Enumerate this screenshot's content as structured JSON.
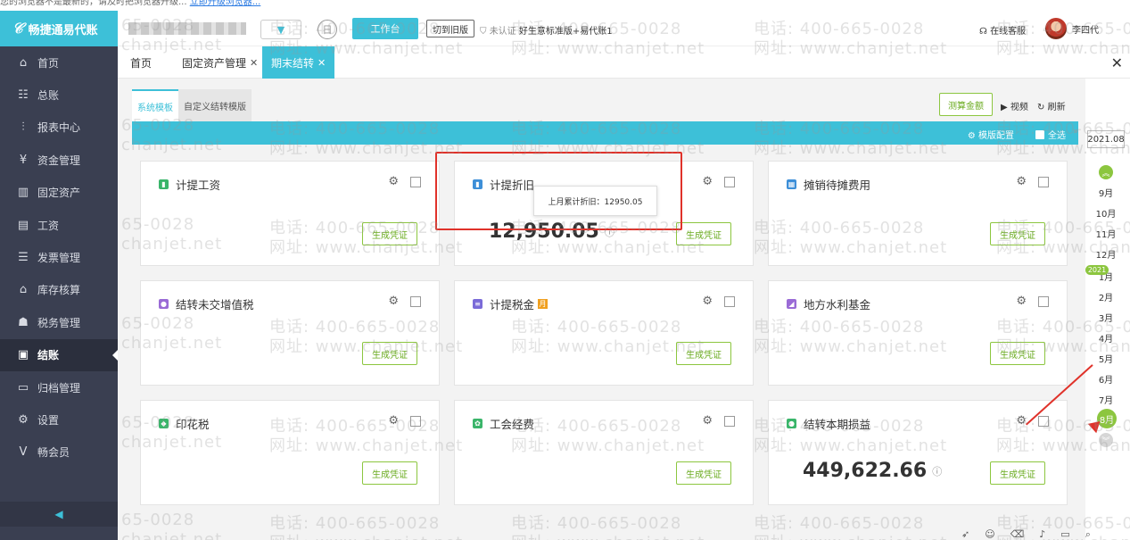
{
  "top_notice": {
    "text": "您的浏览器不是最新的，请及时把浏览器升级...",
    "link": "立即升级浏览器..."
  },
  "sidebar": {
    "brand": "畅捷通易代账",
    "items": [
      {
        "label": "首页",
        "icon": "home-icon",
        "glyph": "⌂"
      },
      {
        "label": "总账",
        "icon": "ledger-icon",
        "glyph": "☷"
      },
      {
        "label": "报表中心",
        "icon": "report-chart-icon",
        "glyph": "⫶"
      },
      {
        "label": "资金管理",
        "icon": "money-bag-icon",
        "glyph": "¥"
      },
      {
        "label": "固定资产",
        "icon": "building-icon",
        "glyph": "▥"
      },
      {
        "label": "工资",
        "icon": "salary-icon",
        "glyph": "▤"
      },
      {
        "label": "发票管理",
        "icon": "invoice-icon",
        "glyph": "☰"
      },
      {
        "label": "库存核算",
        "icon": "warehouse-icon",
        "glyph": "⌂"
      },
      {
        "label": "税务管理",
        "icon": "tax-icon",
        "glyph": "☗"
      },
      {
        "label": "结账",
        "icon": "checkout-icon",
        "glyph": "▣"
      },
      {
        "label": "归档管理",
        "icon": "archive-icon",
        "glyph": "▭"
      },
      {
        "label": "设置",
        "icon": "gear-icon",
        "glyph": "⚙"
      },
      {
        "label": "畅会员",
        "icon": "vip-icon",
        "glyph": "V"
      }
    ],
    "active_index": 9,
    "collapse_glyph": "◀"
  },
  "header": {
    "workbench": "工作台",
    "switch_old": "切到旧版",
    "unverified": "未认证",
    "edition": "好生意标准版+易代账1",
    "service": "在线客服",
    "user_name": "李四代"
  },
  "tabs": [
    {
      "label": "首页",
      "closable": false
    },
    {
      "label": "固定资产管理",
      "closable": true
    },
    {
      "label": "期末结转",
      "closable": true,
      "active": true
    }
  ],
  "toolbar": {
    "subtabs": [
      "系统模板",
      "自定义结转模版"
    ],
    "calc_button": "测算金额",
    "video": "视频",
    "refresh": "刷新",
    "template_config": "模版配置",
    "select_all": "全选"
  },
  "cards": [
    {
      "title": "计提工资",
      "icon_color": "#3ab56a",
      "icon_glyph": "▮",
      "generate": "生成凭证"
    },
    {
      "title": "计提折旧",
      "icon_color": "#3d8fd8",
      "icon_glyph": "▮",
      "amount": "12,950.05",
      "tooltip": "上月累计折旧：12950.05",
      "generate": "生成凭证"
    },
    {
      "title": "摊销待摊费用",
      "icon_color": "#3d8fd8",
      "icon_glyph": "▦",
      "generate": "生成凭证"
    },
    {
      "title": "结转未交增值税",
      "icon_color": "#9a6bd6",
      "icon_glyph": "●",
      "generate": "生成凭证"
    },
    {
      "title": "计提税金",
      "icon_color": "#7a6ad8",
      "icon_glyph": "≡",
      "badge": "月",
      "generate": "生成凭证"
    },
    {
      "title": "地方水利基金",
      "icon_color": "#9a6bd6",
      "icon_glyph": "◢",
      "generate": "生成凭证"
    },
    {
      "title": "印花税",
      "icon_color": "#3ab56a",
      "icon_glyph": "◆",
      "generate": "生成凭证"
    },
    {
      "title": "工会经费",
      "icon_color": "#3ab56a",
      "icon_glyph": "✿",
      "generate": "生成凭证"
    },
    {
      "title": "结转本期损益",
      "icon_color": "#3ab56a",
      "icon_glyph": "●",
      "amount": "449,622.66",
      "generate": "生成凭证"
    }
  ],
  "month_picker": {
    "current": "2021.08",
    "year_badge": "2021",
    "months_before": [
      "9月",
      "10月",
      "11月",
      "12月"
    ],
    "months_after": [
      "1月",
      "2月",
      "3月",
      "4月",
      "5月",
      "6月",
      "7月"
    ],
    "selected": "8月"
  },
  "watermark": {
    "phone": "电话: 400-665-0028",
    "site": "网址: www.chanjet.net",
    "phone_fragment": "65-0028",
    "site_fragment": "chanjet.net"
  }
}
